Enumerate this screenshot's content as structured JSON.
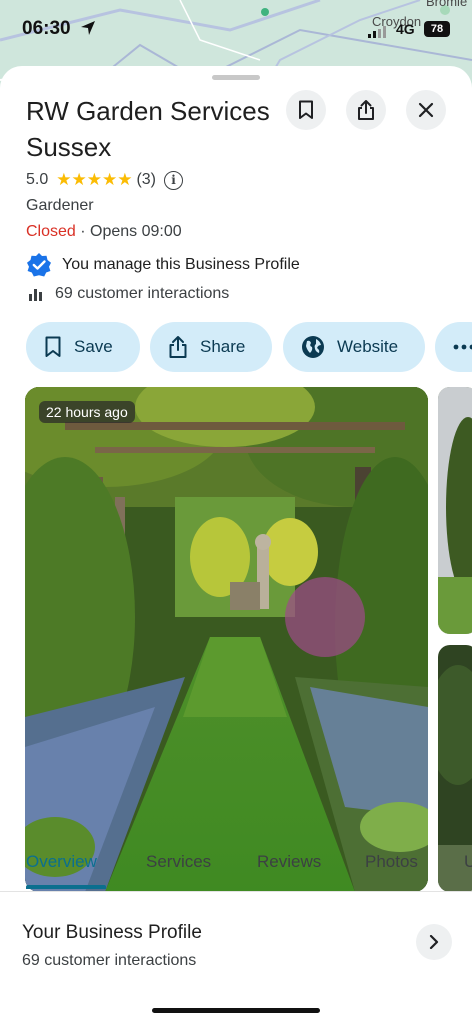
{
  "status_bar": {
    "time": "06:30",
    "network": "4G",
    "battery": "78"
  },
  "map": {
    "place_1": "Croydon",
    "place_2": "Bromle"
  },
  "place": {
    "name": "RW Garden Services Sussex",
    "rating": "5.0",
    "stars": "★★★★★",
    "review_count": "(3)",
    "category": "Gardener",
    "status": "Closed",
    "opens": "· Opens 09:00",
    "manage_text": "You manage this Business Profile",
    "interactions_text": "69 customer interactions"
  },
  "header_icons": [
    "bookmark-icon",
    "share-icon",
    "close-icon"
  ],
  "actions": [
    {
      "label": "Save",
      "icon": "bookmark-icon"
    },
    {
      "label": "Share",
      "icon": "share-icon"
    },
    {
      "label": "Website",
      "icon": "globe-icon"
    },
    {
      "label": "",
      "icon": "more-icon"
    }
  ],
  "photo": {
    "timestamp": "22 hours ago"
  },
  "tabs": [
    {
      "label": "Overview",
      "active": true
    },
    {
      "label": "Services",
      "active": false
    },
    {
      "label": "Reviews",
      "active": false
    },
    {
      "label": "Photos",
      "active": false
    },
    {
      "label": "U",
      "active": false
    }
  ],
  "profile_section": {
    "title": "Your Business Profile",
    "subtitle": "69 customer interactions"
  },
  "colors": {
    "accent": "#0b6f8f",
    "chip_bg": "#d3ecf9",
    "closed": "#d93025",
    "star": "#fbbc04",
    "verified": "#1a73e8"
  }
}
